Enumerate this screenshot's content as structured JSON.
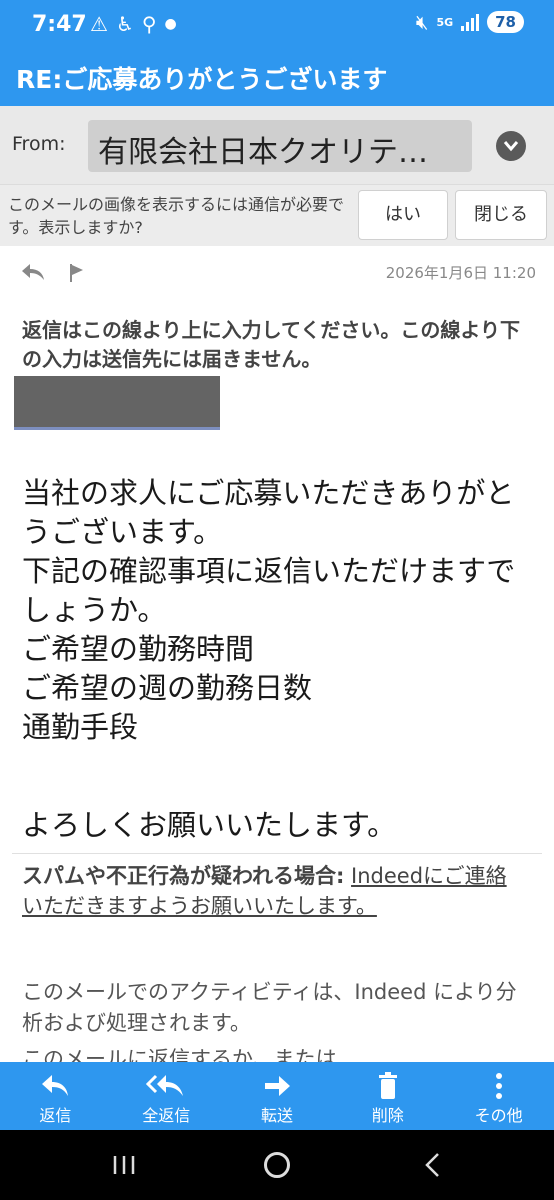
{
  "status_bar": {
    "time": "7:47",
    "network": "5G",
    "battery": "78"
  },
  "header": {
    "title": "RE:ご応募ありがとうございます"
  },
  "from": {
    "label": "From:",
    "value": "有限会社日本クオリテ…"
  },
  "image_notice": {
    "text": "このメールの画像を表示するには通信が必要です。表示しますか?",
    "yes_label": "はい",
    "close_label": "閉じる"
  },
  "message": {
    "date": "2026年1月6日 11:20",
    "reply_note": "返信はこの線より上に入力してください。この線より下の入力は送信先には届きません。",
    "body_lines": [
      "当社の求人にご応募いただきありがとうございます。",
      "下記の確認事項に返信いただけますでしょうか。",
      "ご希望の勤務時間",
      "ご希望の週の勤務日数",
      "通勤手段"
    ],
    "closing": "よろしくお願いいたします。",
    "spam_bold": "スパムや不正行為が疑われる場合:",
    "spam_link": "Indeedにご連絡いただきますようお願いいたします。",
    "activity": "このメールでのアクティビティは、Indeed により分析および処理されます。",
    "cutoff": "このメールに返信するか、または"
  },
  "toolbar": {
    "items": [
      {
        "label": "返信",
        "icon": "reply-icon"
      },
      {
        "label": "全返信",
        "icon": "reply-all-icon"
      },
      {
        "label": "転送",
        "icon": "forward-icon"
      },
      {
        "label": "削除",
        "icon": "trash-icon"
      },
      {
        "label": "その他",
        "icon": "more-vertical-icon"
      }
    ]
  },
  "colors": {
    "accent": "#2e97ef",
    "nav_bg": "#000000"
  }
}
